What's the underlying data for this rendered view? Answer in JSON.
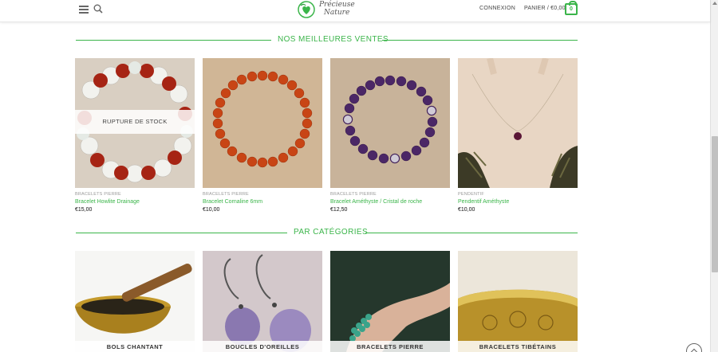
{
  "header": {
    "brand_line1": "Précieuse",
    "brand_line2": "Nature",
    "login_label": "CONNEXION",
    "cart_label": "PANIER / €0,00",
    "cart_count": "0",
    "top_cut_text": "€ 0,00"
  },
  "best_sellers": {
    "title": "NOS MEILLEURES VENTES",
    "products": [
      {
        "category": "BRACELETS PIERRE",
        "name": "Bracelet Howlite Drainage",
        "price": "€15,00",
        "badge": "RUPTURE DE STOCK"
      },
      {
        "category": "BRACELETS PIERRE",
        "name": "Bracelet Cornaline 6mm",
        "price": "€10,00"
      },
      {
        "category": "BRACELETS PIERRE",
        "name": "Bracelet Améthyste / Cristal de roche",
        "price": "€12,50"
      },
      {
        "category": "PENDENTIF",
        "name": "Pendentif Améthyste",
        "price": "€10,00"
      }
    ]
  },
  "categories": {
    "title": "PAR CATÉGORIES",
    "items": [
      {
        "label": "BOLS CHANTANT"
      },
      {
        "label": "BOUCLES D'OREILLES"
      },
      {
        "label": "BRACELETS PIERRE"
      },
      {
        "label": "BRACELETS TIBÉTAINS"
      }
    ]
  },
  "colors": {
    "accent": "#3bb54a",
    "text": "#333333"
  },
  "icons": [
    "menu-icon",
    "search-icon",
    "cart-icon",
    "back-to-top-icon"
  ]
}
